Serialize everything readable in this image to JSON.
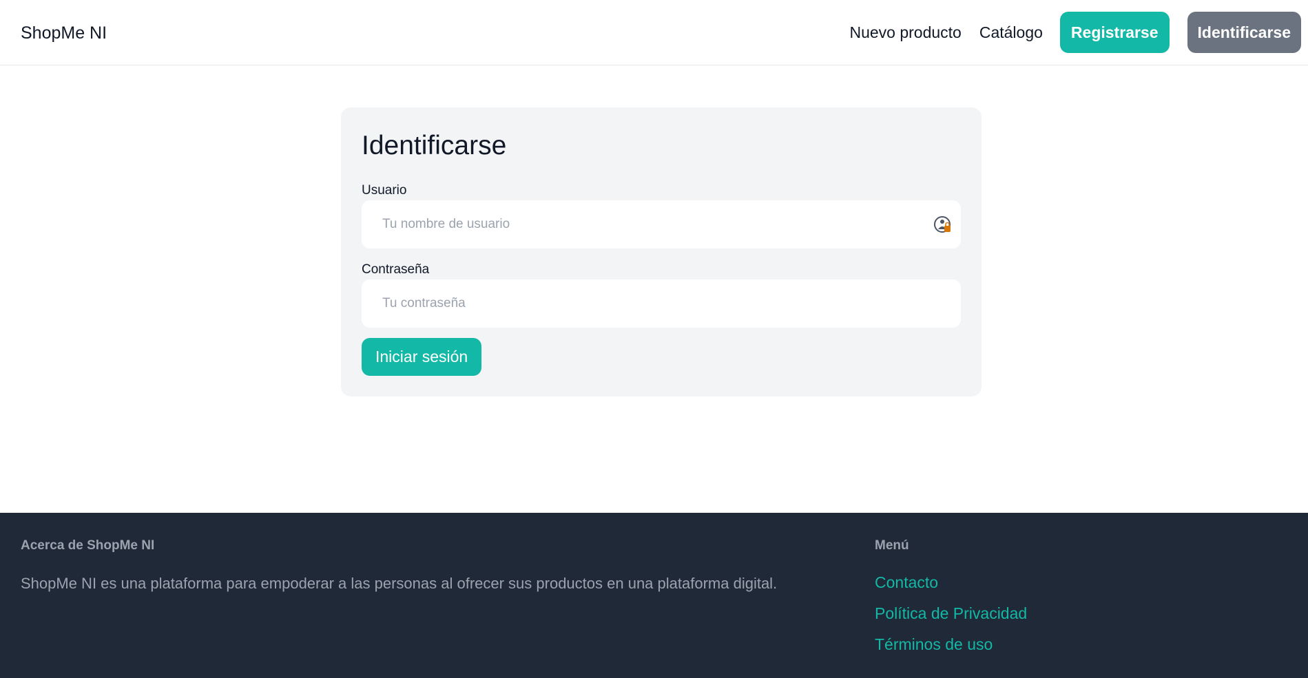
{
  "header": {
    "brand": "ShopMe NI",
    "nav": {
      "new_product": "Nuevo producto",
      "catalog": "Catálogo",
      "register": "Registrarse",
      "login": "Identificarse"
    }
  },
  "login_form": {
    "title": "Identificarse",
    "username": {
      "label": "Usuario",
      "placeholder": "Tu nombre de usuario",
      "value": ""
    },
    "password": {
      "label": "Contraseña",
      "placeholder": "Tu contraseña",
      "value": ""
    },
    "submit_label": "Iniciar sesión",
    "username_field_icon": "password-manager-icon"
  },
  "footer": {
    "about_heading": "Acerca de ShopMe NI",
    "about_text": "ShopMe NI es una plataforma para empoderar a las personas al ofrecer sus productos en una plataforma digital.",
    "menu_heading": "Menú",
    "links": [
      {
        "label": "Contacto"
      },
      {
        "label": "Política de Privacidad"
      },
      {
        "label": "Términos de uso"
      }
    ]
  },
  "colors": {
    "accent": "#14b8a6",
    "secondary_button": "#6b7280",
    "card_bg": "#f3f4f6",
    "footer_bg": "#1f2937",
    "muted_text": "#9ca3af"
  }
}
